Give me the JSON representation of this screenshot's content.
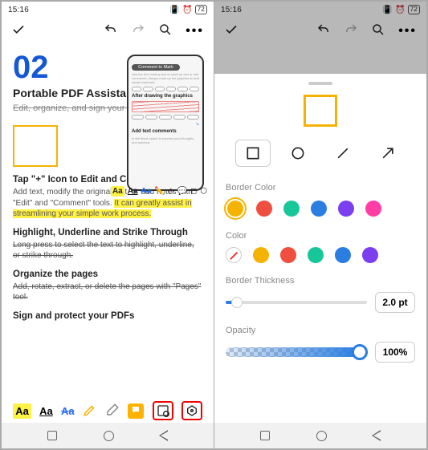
{
  "status": {
    "time": "15:16",
    "battery": "72"
  },
  "doc": {
    "number": "02",
    "title": "Portable PDF Assistant",
    "subtitle": "Edit, organize, and sign your files easily.",
    "mock": {
      "pill": "Comment to Mark",
      "sec1": "After drawing the graphics",
      "sec2": "Add text comments"
    },
    "h1": "Tap \"+\" Icon to Edit and Comment",
    "p1a": "Add text, modify the original text, or add notes with \"Edit\" and \"Comment\" tools. ",
    "p1b": "It can greatly assist in streamlining your simple work process.",
    "h2": "Highlight, Underline and Strike Through",
    "p2": "Long press to select the text to highlight, underline, or strike through.",
    "h3": "Organize the pages",
    "p3": "Add, rotate, extract, or delete the pages with \"Pages\" tool.",
    "h4": "Sign and protect your PDFs"
  },
  "tools": {
    "aa_highlight": "Aa",
    "aa_underline": "Aa",
    "aa_strike": "Aa"
  },
  "sheet": {
    "border_color_label": "Border Color",
    "color_label": "Color",
    "thickness_label": "Border Thickness",
    "opacity_label": "Opacity",
    "thickness_value": "2.0 pt",
    "opacity_value": "100%",
    "thickness_pct": 8,
    "opacity_pct": 95,
    "border_colors": [
      "#f5b301",
      "#f04e3e",
      "#17c79a",
      "#2a7de1",
      "#7b3ff0",
      "#ff3ea5"
    ],
    "fill_colors": [
      "none",
      "#f5b301",
      "#f04e3e",
      "#17c79a",
      "#2a7de1",
      "#7b3ff0"
    ]
  }
}
